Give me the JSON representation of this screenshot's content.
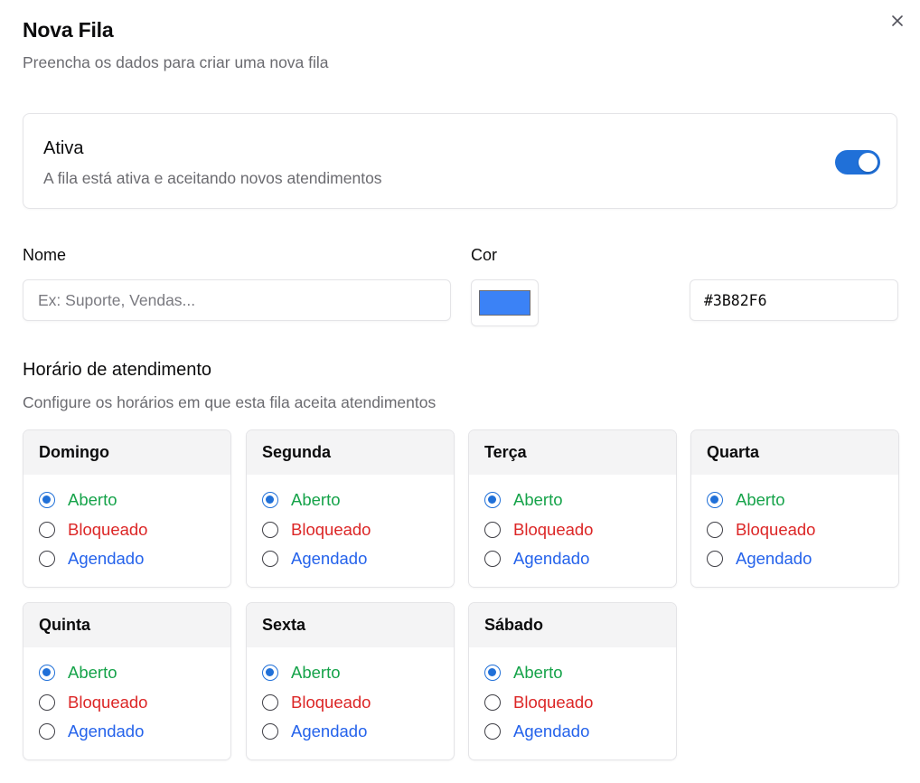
{
  "dialog": {
    "title": "Nova Fila",
    "subtitle": "Preencha os dados para criar uma nova fila",
    "close_icon": "close-icon"
  },
  "active": {
    "title": "Ativa",
    "description": "A fila está ativa e aceitando novos atendimentos",
    "enabled": true,
    "toggle_color": "#2070D8"
  },
  "form": {
    "name_label": "Nome",
    "name_value": "",
    "name_placeholder": "Ex: Suporte, Vendas...",
    "color_label": "Cor",
    "color_value": "#3B82F6"
  },
  "schedule": {
    "title": "Horário de atendimento",
    "description": "Configure os horários em que esta fila aceita atendimentos",
    "option_labels": {
      "open": "Aberto",
      "blocked": "Bloqueado",
      "scheduled": "Agendado"
    },
    "option_colors": {
      "open": "#16A34A",
      "blocked": "#DC2626",
      "scheduled": "#2563EB"
    },
    "days": [
      {
        "name": "Domingo",
        "selected": "open"
      },
      {
        "name": "Segunda",
        "selected": "open"
      },
      {
        "name": "Terça",
        "selected": "open"
      },
      {
        "name": "Quarta",
        "selected": "open"
      },
      {
        "name": "Quinta",
        "selected": "open"
      },
      {
        "name": "Sexta",
        "selected": "open"
      },
      {
        "name": "Sábado",
        "selected": "open"
      }
    ]
  }
}
